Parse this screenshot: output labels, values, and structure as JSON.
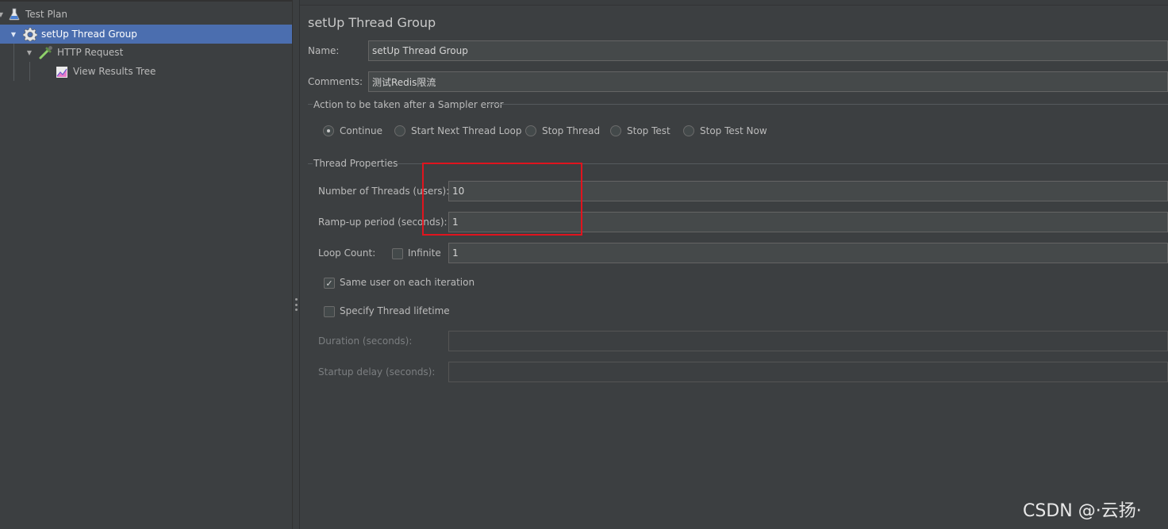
{
  "tree": {
    "items": [
      {
        "label": "Test Plan"
      },
      {
        "label": "setUp Thread Group"
      },
      {
        "label": "HTTP Request"
      },
      {
        "label": "View Results Tree"
      }
    ]
  },
  "panel": {
    "title": "setUp Thread Group",
    "name_label": "Name:",
    "name_value": "setUp Thread Group",
    "comments_label": "Comments:",
    "comments_value": "测试Redis限流",
    "sampler_error": {
      "legend": "Action to be taken after a Sampler error",
      "options": [
        "Continue",
        "Start Next Thread Loop",
        "Stop Thread",
        "Stop Test",
        "Stop Test Now"
      ],
      "selected": "Continue"
    },
    "thread_properties": {
      "legend": "Thread Properties",
      "threads_label": "Number of Threads (users):",
      "threads_value": "10",
      "rampup_label": "Ramp-up period (seconds):",
      "rampup_value": "1",
      "loop_label": "Loop Count:",
      "infinite_label": "Infinite",
      "infinite_checked": false,
      "loop_value": "1",
      "same_user_label": "Same user on each iteration",
      "same_user_checked": true,
      "lifetime_label": "Specify Thread lifetime",
      "lifetime_checked": false,
      "duration_label": "Duration (seconds):",
      "duration_value": "",
      "startup_label": "Startup delay (seconds):",
      "startup_value": ""
    }
  },
  "watermark": "CSDN @·云扬·",
  "colors": {
    "background": "#3c3f41",
    "selection": "#4b6eaf",
    "highlight_box": "#e0141e",
    "field_bg": "#45494a"
  },
  "icons": {
    "test_plan": "flask-icon",
    "thread_group": "gear-icon",
    "http_request": "pipette-icon",
    "results_tree": "graph-icon"
  }
}
